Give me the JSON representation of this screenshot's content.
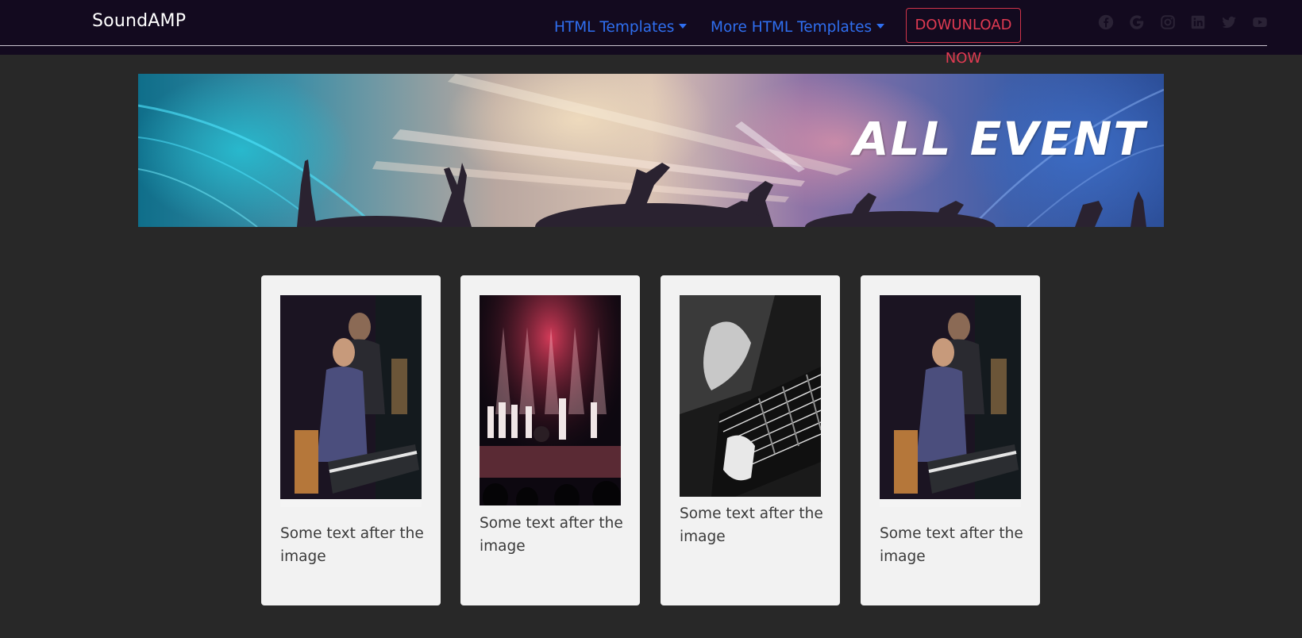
{
  "navbar": {
    "brand": "SoundAMP",
    "links": [
      {
        "label": "HTML Templates"
      },
      {
        "label": "More HTML Templates"
      }
    ],
    "download_label": "DOWUNLOAD NOW",
    "social_icons": [
      "facebook-icon",
      "google-icon",
      "instagram-icon",
      "linkedin-icon",
      "twitter-icon",
      "youtube-icon"
    ]
  },
  "hero": {
    "title": "ALL EVENT"
  },
  "cards": [
    {
      "image": "pianist-singer-photo",
      "caption": "Some text after the image"
    },
    {
      "image": "band-on-stage-photo",
      "caption": "Some text after the image"
    },
    {
      "image": "guitar-closeup-photo",
      "caption": "Some text after the image"
    },
    {
      "image": "pianist-singer-photo",
      "caption": "Some text after the image"
    }
  ],
  "colors": {
    "navbar_bg": "#130a1f",
    "page_bg": "#282828",
    "nav_link": "#2f6ff0",
    "download_accent": "#e03a52",
    "card_bg": "#f2f2f2"
  }
}
